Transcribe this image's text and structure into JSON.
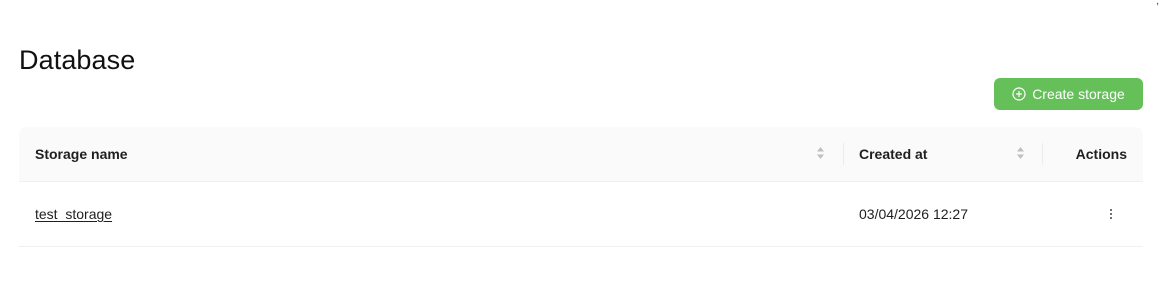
{
  "page": {
    "title": "Database"
  },
  "toolbar": {
    "create_label": "Create storage",
    "create_icon": "plus-circle-icon",
    "accent_color": "#66c05a"
  },
  "table": {
    "columns": {
      "name": "Storage name",
      "created": "Created at",
      "actions": "Actions"
    },
    "rows": [
      {
        "name": "test_storage",
        "created": "03/04/2026 12:27",
        "actions_icon": "more-vertical-icon"
      }
    ]
  }
}
